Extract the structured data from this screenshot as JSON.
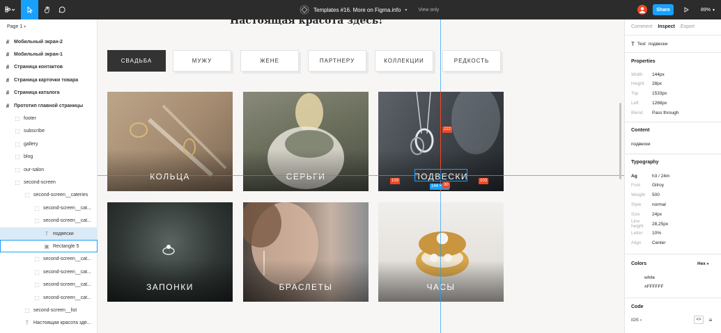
{
  "toolbar": {
    "title": "Templates #16. More on Figma.info",
    "view_only": "View only",
    "share": "Share",
    "zoom": "89%",
    "accent": "#18a0fb"
  },
  "left": {
    "page": "Page 1",
    "layers": [
      {
        "label": "Мобильный экран-2",
        "icon": "frame-icon",
        "bold": true
      },
      {
        "label": "Мобильный экран-1",
        "icon": "frame-icon",
        "bold": true
      },
      {
        "label": "Страница контактов",
        "icon": "frame-icon",
        "bold": true
      },
      {
        "label": "Страница карточки товара",
        "icon": "frame-icon",
        "bold": true
      },
      {
        "label": "Страница каталога",
        "icon": "frame-icon",
        "bold": true
      },
      {
        "label": "Прототип главной страницы",
        "icon": "frame-icon",
        "bold": true
      },
      {
        "label": "footer",
        "icon": "group-icon"
      },
      {
        "label": "subscribe",
        "icon": "group-icon"
      },
      {
        "label": "gallery",
        "icon": "group-icon"
      },
      {
        "label": "blog",
        "icon": "group-icon"
      },
      {
        "label": "our-salon",
        "icon": "group-icon"
      },
      {
        "label": "second-screen",
        "icon": "group-icon"
      },
      {
        "label": "second-screen__cateries",
        "icon": "group-icon"
      },
      {
        "label": "second-screen__cat...",
        "icon": "group-icon"
      },
      {
        "label": "second-screen__cat...",
        "icon": "group-icon"
      },
      {
        "label": "подвески",
        "icon": "text-icon"
      },
      {
        "label": "Rectangle 5",
        "icon": "image-icon"
      },
      {
        "label": "second-screen__cat...",
        "icon": "group-icon"
      },
      {
        "label": "second-screen__cat...",
        "icon": "group-icon"
      },
      {
        "label": "second-screen__cat...",
        "icon": "group-icon"
      },
      {
        "label": "second-screen__cat...",
        "icon": "group-icon"
      },
      {
        "label": "second-screen__list",
        "icon": "group-icon"
      },
      {
        "label": "Настоящая красота зде...",
        "icon": "text-icon"
      }
    ]
  },
  "canvas": {
    "headline": "Настоящая красота здесь!",
    "tabs": [
      "СВАДЬБА",
      "МУЖУ",
      "ЖЕНЕ",
      "ПАРТНЕРУ",
      "КОЛЛЕКЦИИ",
      "РЕДКОСТЬ"
    ],
    "cards": [
      "КОЛЬЦА",
      "СЕРЬГИ",
      "ПОДВЕСКИ",
      "ЗАПОНКИ",
      "БРАСЛЕТЫ",
      "ЧАСЫ"
    ],
    "measures": {
      "top": "222",
      "left": "103",
      "right": "103",
      "bottom": "30",
      "size": "144 × 28"
    }
  },
  "right": {
    "tabs": [
      "Comment",
      "Inspect",
      "Export"
    ],
    "selected_type": "Text",
    "selected_name": "подвески",
    "properties_head": "Properties",
    "properties": [
      {
        "k": "Width",
        "v": "144px"
      },
      {
        "k": "Height",
        "v": "28px"
      },
      {
        "k": "Top",
        "v": "1533px"
      },
      {
        "k": "Left",
        "v": "1268px"
      },
      {
        "k": "Blend",
        "v": "Pass through"
      }
    ],
    "content_head": "Content",
    "content": "подвески",
    "typography_head": "Typography",
    "typography": [
      {
        "k": "Ag",
        "v": "h3 / 24m"
      },
      {
        "k": "Font",
        "v": "Gilroy"
      },
      {
        "k": "Weight",
        "v": "500"
      },
      {
        "k": "Style",
        "v": "normal"
      },
      {
        "k": "Size",
        "v": "24px"
      },
      {
        "k": "Line height",
        "v": "28,25px"
      },
      {
        "k": "Letter",
        "v": "10%"
      },
      {
        "k": "Align",
        "v": "Center"
      }
    ],
    "colors_head": "Colors",
    "color_format": "Hex",
    "color_name": "white",
    "color_hex": "#FFFFFF",
    "code_head": "Code",
    "code_lang": "iOS"
  }
}
